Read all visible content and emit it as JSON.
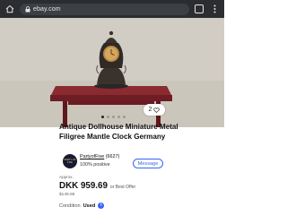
{
  "browser": {
    "url": "ebay.com",
    "tabs_count": "",
    "icons": [
      "home-icon",
      "lock-icon",
      "tabs-icon",
      "more-icon"
    ]
  },
  "gallery": {
    "image_description_icon": "photo",
    "dots_total": 5,
    "active_dot": 0,
    "watch_count": "2"
  },
  "listing": {
    "title": "Antique Dollhouse Miniature Metal Filigree Mantle Clock Germany"
  },
  "seller": {
    "name": "PartyofFive",
    "feedback_count": "(6627)",
    "positive": "100% positive",
    "logo_text": "PARTY OF FIVE",
    "message_label": "Message"
  },
  "price": {
    "approx_label": "Approx.",
    "value": "DKK 959.69",
    "best_offer": "or Best Offer",
    "original": "$149.95"
  },
  "condition": {
    "label": "Condition",
    "value": "Used"
  },
  "colors": {
    "accent": "#3665f3",
    "browser_bar": "#2b2d30"
  }
}
